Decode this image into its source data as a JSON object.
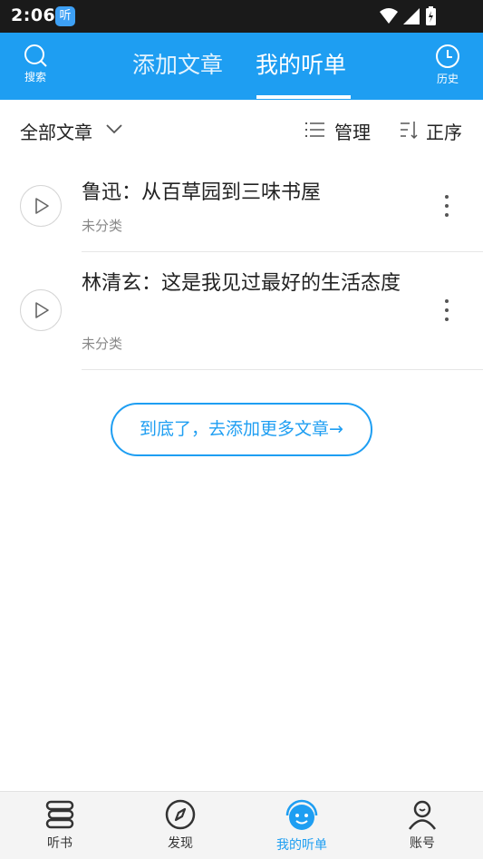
{
  "status_bar": {
    "time": "2:06",
    "app_icon_text": "听"
  },
  "header": {
    "search_label": "搜索",
    "history_label": "历史",
    "tabs": [
      {
        "label": "添加文章",
        "active": false
      },
      {
        "label": "我的听单",
        "active": true
      }
    ],
    "accent_color": "#1e9ef2"
  },
  "filter": {
    "all_label": "全部文章",
    "manage_label": "管理",
    "order_label": "正序"
  },
  "articles": [
    {
      "title": "鲁迅：从百草园到三味书屋",
      "category": "未分类"
    },
    {
      "title": "林清玄：这是我见过最好的生活态度",
      "category": "未分类"
    }
  ],
  "end_button_label": "到底了，去添加更多文章→",
  "bottom_nav": [
    {
      "label": "听书",
      "icon": "bookshelf-icon",
      "active": false
    },
    {
      "label": "发现",
      "icon": "compass-icon",
      "active": false
    },
    {
      "label": "我的听单",
      "icon": "smile-face-icon",
      "active": true
    },
    {
      "label": "账号",
      "icon": "user-icon",
      "active": false
    }
  ]
}
